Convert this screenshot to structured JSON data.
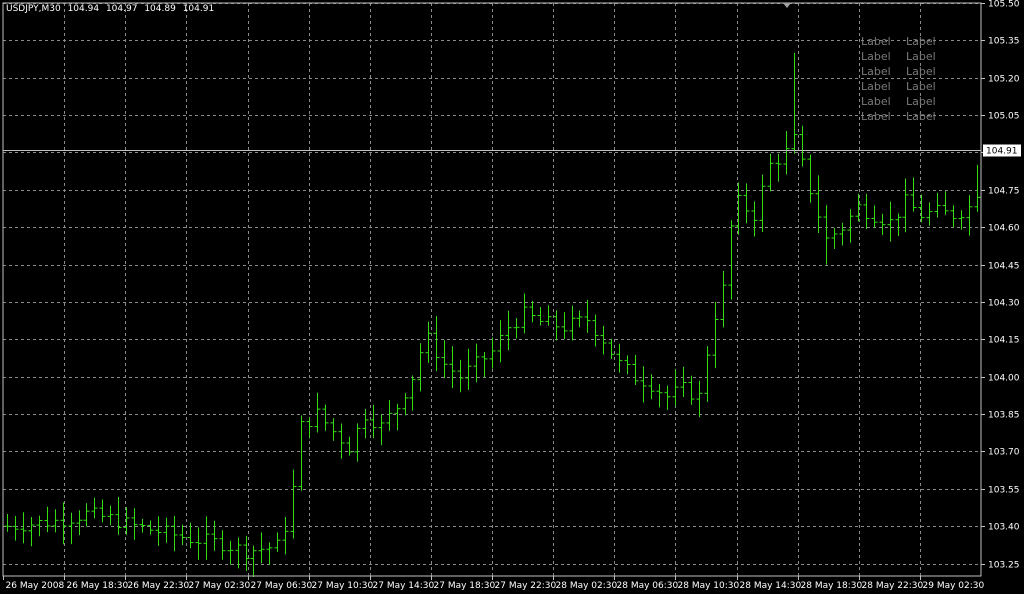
{
  "header": {
    "symbol": "USDJPY,M30",
    "open": "104.94",
    "high": "104.97",
    "low": "104.89",
    "close": "104.91"
  },
  "labels": [
    [
      "Label",
      "Label"
    ],
    [
      "Label",
      "Label"
    ],
    [
      "Label",
      "Label"
    ],
    [
      "Label",
      "Label"
    ],
    [
      "Label",
      "Label"
    ],
    [
      "Label",
      "Label"
    ]
  ],
  "colors": {
    "background": "#000000",
    "grid": "#8a8a8a",
    "bars": "#33dd11",
    "axis": "#c0c0c0",
    "text": "#ffffff",
    "label": "#7a7a7a"
  },
  "chart_data": {
    "type": "ohlc",
    "symbol": "USDJPY",
    "timeframe": "M30",
    "price_ticks": [
      "105.50",
      "105.35",
      "105.20",
      "105.05",
      "104.90",
      "104.75",
      "104.60",
      "104.45",
      "104.30",
      "104.15",
      "104.00",
      "103.85",
      "103.70",
      "103.55",
      "103.40",
      "103.25"
    ],
    "current_price": "104.91",
    "time_labels": [
      "26 May 2008",
      "26 May 18:30",
      "26 May 22:30",
      "27 May 02:30",
      "27 May 06:30",
      "27 May 10:30",
      "27 May 14:30",
      "27 May 18:30",
      "27 May 22:30",
      "28 May 02:30",
      "28 May 06:30",
      "28 May 10:30",
      "28 May 14:30",
      "28 May 18:30",
      "28 May 22:30",
      "29 May 02:30"
    ],
    "ylim": [
      103.2,
      105.5
    ],
    "close_path": [
      [
        0,
        103.4
      ],
      [
        6,
        103.42
      ],
      [
        10,
        103.45
      ],
      [
        13,
        103.43
      ],
      [
        16,
        103.4
      ],
      [
        19,
        103.38
      ],
      [
        23,
        103.35
      ],
      [
        27,
        103.33
      ],
      [
        30,
        103.3
      ],
      [
        34,
        103.32
      ],
      [
        35,
        103.4
      ],
      [
        36,
        103.55
      ],
      [
        37,
        103.8
      ],
      [
        39,
        103.85
      ],
      [
        41,
        103.78
      ],
      [
        43,
        103.72
      ],
      [
        45,
        103.85
      ],
      [
        47,
        103.8
      ],
      [
        49,
        103.88
      ],
      [
        51,
        104.0
      ],
      [
        52,
        104.1
      ],
      [
        53,
        104.15
      ],
      [
        55,
        104.05
      ],
      [
        57,
        104.0
      ],
      [
        59,
        104.05
      ],
      [
        61,
        104.1
      ],
      [
        63,
        104.2
      ],
      [
        65,
        104.25
      ],
      [
        67,
        104.22
      ],
      [
        70,
        104.2
      ],
      [
        73,
        104.23
      ],
      [
        75,
        104.15
      ],
      [
        77,
        104.05
      ],
      [
        79,
        104.0
      ],
      [
        81,
        103.97
      ],
      [
        83,
        103.92
      ],
      [
        85,
        103.95
      ],
      [
        87,
        103.92
      ],
      [
        88,
        104.1
      ],
      [
        89,
        104.25
      ],
      [
        90,
        104.35
      ],
      [
        91,
        104.6
      ],
      [
        92,
        104.7
      ],
      [
        94,
        104.65
      ],
      [
        95,
        104.75
      ],
      [
        96,
        104.85
      ],
      [
        98,
        104.9
      ],
      [
        99,
        104.95
      ],
      [
        100,
        104.85
      ],
      [
        101,
        104.75
      ],
      [
        102,
        104.65
      ],
      [
        103,
        104.55
      ],
      [
        105,
        104.6
      ],
      [
        107,
        104.68
      ],
      [
        109,
        104.65
      ],
      [
        111,
        104.62
      ],
      [
        113,
        104.7
      ],
      [
        115,
        104.65
      ],
      [
        117,
        104.66
      ],
      [
        119,
        104.65
      ],
      [
        121,
        104.68
      ],
      [
        122,
        104.8
      ]
    ]
  }
}
